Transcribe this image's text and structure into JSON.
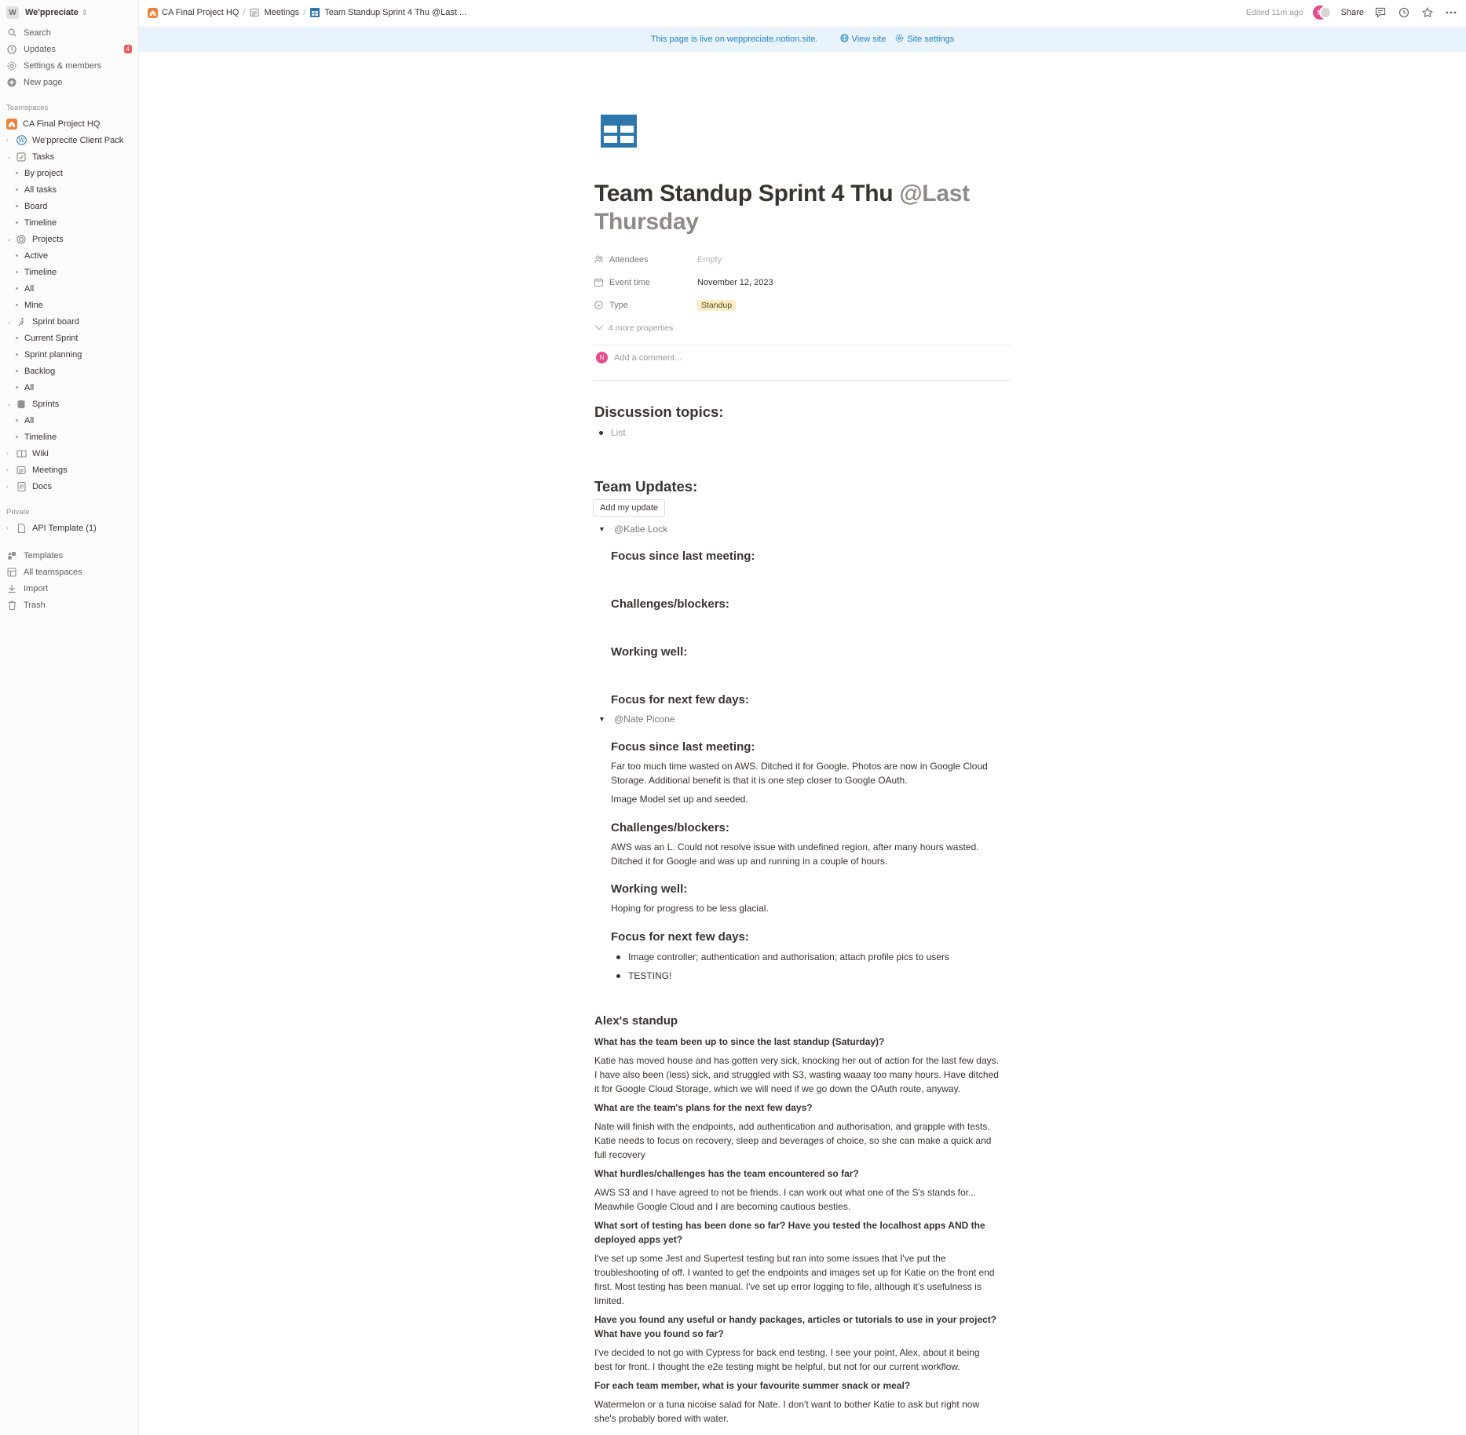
{
  "sidebar": {
    "workspace": {
      "badge": "W",
      "name": "We'ppreciate"
    },
    "top_items": [
      {
        "label": "Search"
      },
      {
        "label": "Updates",
        "badge": "4"
      },
      {
        "label": "Settings & members"
      },
      {
        "label": "New page"
      }
    ],
    "teamspaces_heading": "Teamspaces",
    "teamspaces": [
      {
        "label": "CA Final Project HQ"
      },
      {
        "label": "We'pprecite Client Pack"
      },
      {
        "label": "Tasks"
      },
      {
        "label": "By project"
      },
      {
        "label": "All tasks"
      },
      {
        "label": "Board"
      },
      {
        "label": "Timeline"
      },
      {
        "label": "Projects"
      },
      {
        "label": "Active"
      },
      {
        "label": "Timeline"
      },
      {
        "label": "All"
      },
      {
        "label": "Mine"
      },
      {
        "label": "Sprint board"
      },
      {
        "label": "Current Sprint"
      },
      {
        "label": "Sprint planning"
      },
      {
        "label": "Backlog"
      },
      {
        "label": "All"
      },
      {
        "label": "Sprints"
      },
      {
        "label": "All"
      },
      {
        "label": "Timeline"
      },
      {
        "label": "Wiki"
      },
      {
        "label": "Meetings"
      },
      {
        "label": "Docs"
      }
    ],
    "private_heading": "Private",
    "private": [
      {
        "label": "API Template (1)"
      }
    ],
    "bottom_items": [
      {
        "label": "Templates"
      },
      {
        "label": "All teamspaces"
      },
      {
        "label": "Import"
      },
      {
        "label": "Trash"
      }
    ]
  },
  "topbar": {
    "breadcrumbs": [
      "CA Final Project HQ",
      "Meetings",
      "Team Standup Sprint 4 Thu @Last ..."
    ],
    "edited": "Edited 11m ago",
    "avatar_initial": "N",
    "share": "Share"
  },
  "banner": {
    "text": "This page is live on weppreciate.notion.site.",
    "view_site": "View site",
    "site_settings": "Site settings"
  },
  "page": {
    "title": "Team Standup Sprint 4 Thu",
    "title_mention": "@Last Thursday",
    "properties": [
      {
        "key": "Attendees",
        "value": "Empty"
      },
      {
        "key": "Event time",
        "value": "November 12, 2023"
      },
      {
        "key": "Type",
        "value": "Standup"
      }
    ],
    "more_properties": "4 more properties",
    "comment_placeholder": "Add a comment...",
    "comment_avatar": "N",
    "discussion_heading": "Discussion topics:",
    "discussion_list": "List",
    "updates_heading": "Team Updates:",
    "add_update_button": "Add my update",
    "katie": {
      "mention": "@Katie Lock",
      "h_focus": "Focus since last meeting:",
      "h_challenges": "Challenges/blockers:",
      "h_working": "Working well:",
      "h_next": "Focus for next few days:"
    },
    "nate": {
      "mention": "@Nate Picone",
      "h_focus": "Focus since last meeting:",
      "focus_p1_l1": "Far too much time wasted on AWS. Ditched it for Google. Photos are now in Google Cloud",
      "focus_p1_l2": "Storage. Additional benefit is that it is one step closer to Google OAuth.",
      "focus_p2": "Image Model set up and seeded.",
      "h_challenges": "Challenges/blockers:",
      "challenges_l1": "AWS was an L. Could not resolve issue with undefined region, after many hours wasted.",
      "challenges_l2": "Ditched it for Google and was up and running in a couple of hours.",
      "h_working": "Working well:",
      "working": "Hoping for progress to be less glacial.",
      "h_next": "Focus for next few days:",
      "next_items": [
        "Image controller; authentication and authorisation; attach profile pics to users",
        "TESTING!"
      ]
    },
    "alex": {
      "heading": "Alex's standup",
      "q1": "What has the team been up to since the last standup (Saturday)?",
      "a1": [
        "Katie has moved house and has gotten very sick, knocking her out of action for the last few days.",
        "I have also been (less) sick, and struggled with S3, wasting waaay too many hours. Have ditched",
        "it for Google Cloud Storage, which we will need if we go down the OAuth route, anyway."
      ],
      "q2": "What are the team's plans for the next few days?",
      "a2": [
        "Nate will finish with the endpoints, add authentication and authorisation, and grapple with tests.",
        "Katie needs to focus on recovery, sleep and beverages of choice, so she can make a quick and",
        "full recovery"
      ],
      "q3": "What hurdles/challenges has the team encountered so far?",
      "a3": [
        "AWS S3 and I have agreed to not be friends. I can work out what one of the S's stands for...",
        "Meawhile Google Cloud and I are becoming cautious besties."
      ],
      "q4": [
        "What sort of testing has been done so far? Have you tested the localhost apps AND the",
        "deployed apps yet?"
      ],
      "a4": [
        "I've set up some Jest and Supertest testing but ran into some issues that I've put the",
        "troubleshooting of off. I wanted to get the endpoints and images set up for Katie on the front end",
        "first. Most testing has been manual. I've set up error logging to file, although it's usefulness is",
        "limited."
      ],
      "q5": [
        "Have you found any useful or handy packages, articles or tutorials to use in your project?",
        "What have you found so far?"
      ],
      "a5": [
        "I've decided to not go with Cypress for back end testing. I see your point, Alex, about it being",
        "best for front. I thought the e2e testing might be helpful, but not for our current workflow."
      ],
      "q6": "For each team member, what is your favourite summer snack or meal?",
      "a6": [
        "Watermelon or a tuna nicoise salad for Nate. I don't want to bother Katie to ask but right now",
        "she's probably bored with water."
      ]
    }
  },
  "colors": {
    "accent": "#2383c4",
    "banner_bg": "#e9f3fb",
    "tag_bg": "#fbecc8",
    "badge_red": "#eb5757",
    "avatar_pink": "#e54b8a",
    "page_icon_blue": "#2e77ab"
  }
}
